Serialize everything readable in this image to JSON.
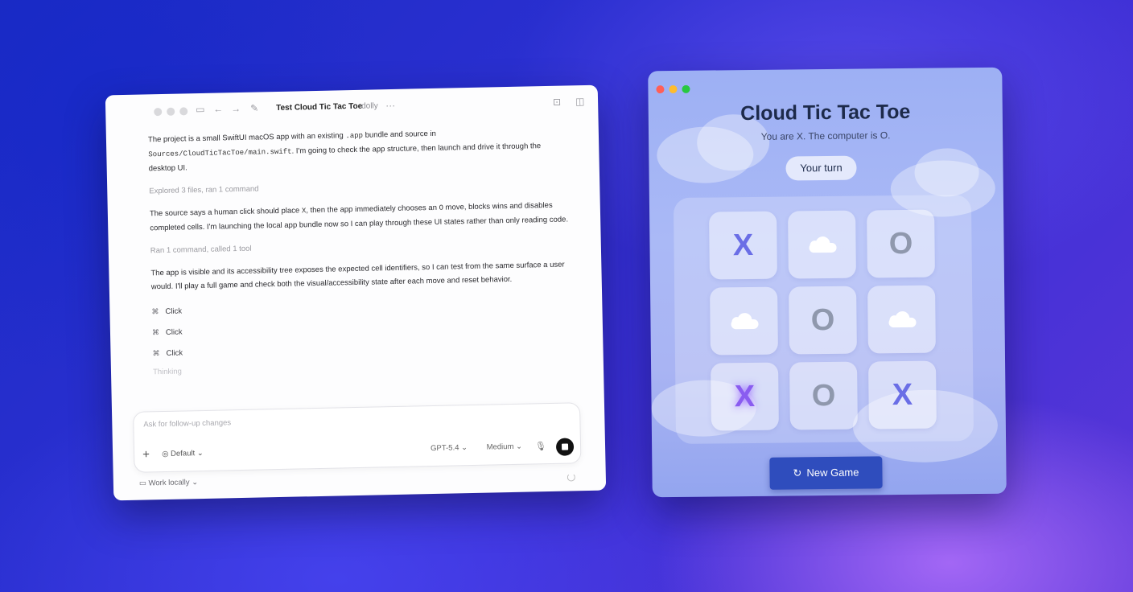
{
  "chat": {
    "title": "Test Cloud Tic Tac Toe",
    "subtitle": "dolly",
    "more_icon": "···",
    "messages": [
      {
        "type": "text",
        "parts": [
          "The project is a small SwiftUI macOS app with an existing ",
          ".app",
          " bundle and source in ",
          "Sources/CloudTicTacToe/main.swift",
          ". I'm going to check the app structure, then launch and drive it through the desktop UI."
        ]
      },
      {
        "type": "meta",
        "text": "Explored 3 files, ran 1 command"
      },
      {
        "type": "text",
        "parts": [
          "The source says a human click should place ",
          "X",
          ", then the app immediately chooses an ",
          "O",
          " move, blocks wins and disables completed cells. I'm launching the local app bundle now so I can play through these UI states rather than only reading code."
        ]
      },
      {
        "type": "meta",
        "text": "Ran 1 command, called 1 tool"
      },
      {
        "type": "text",
        "parts": [
          "The app is visible and its accessibility tree exposes the expected cell identifiers, so I can test from the same surface a user would. I'll play a full game and check both the visual/accessibility state after each move and reset behavior."
        ]
      }
    ],
    "actions": [
      {
        "icon": "⌘",
        "label": "Click"
      },
      {
        "icon": "⌘",
        "label": "Click"
      },
      {
        "icon": "⌘",
        "label": "Click"
      }
    ],
    "thinking": "Thinking",
    "composer": {
      "placeholder": "Ask for follow-up changes",
      "plus": "+",
      "permission": "Default",
      "model": "GPT-5.4",
      "effort": "Medium"
    },
    "footer": {
      "work_mode": "Work locally"
    }
  },
  "game": {
    "title": "Cloud Tic Tac Toe",
    "subtitle": "You are X. The computer is O.",
    "status": "Your turn",
    "new_game_label": "New Game",
    "board": [
      "X",
      "cloud",
      "O",
      "cloud",
      "O",
      "cloud",
      "X",
      "O",
      "X"
    ],
    "colors": {
      "x": "#6a6ee6",
      "o": "#8f98ad",
      "button": "#2f4dbd",
      "traffic_red": "#ff5f57",
      "traffic_yellow": "#febc2e",
      "traffic_green": "#28c840"
    }
  }
}
